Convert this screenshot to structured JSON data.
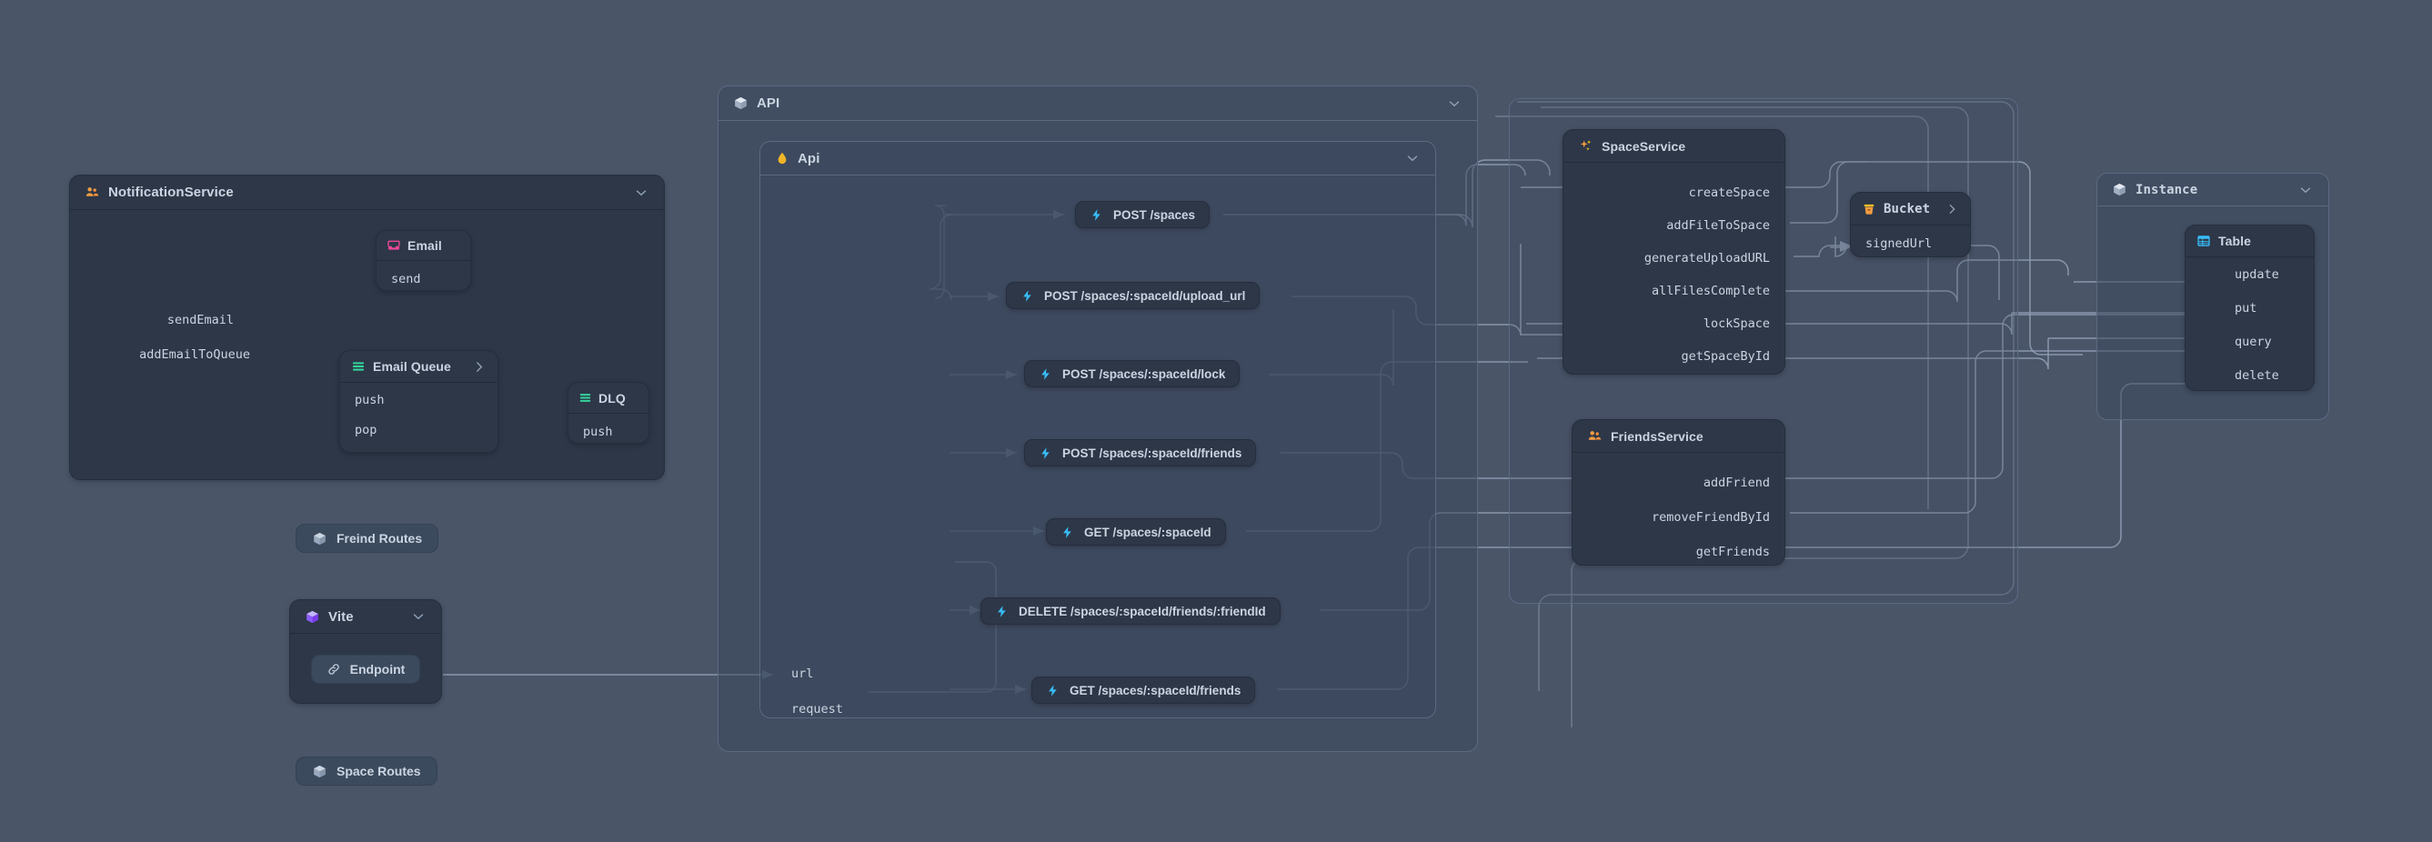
{
  "canvas": {
    "background": "#4a5568",
    "node_bg": "#2d3748",
    "group_bg": "rgba(57,70,92,.52)",
    "edge_color": "#94a3b8",
    "text_color": "#cbd5e1"
  },
  "nodes": {
    "notification_service": {
      "title": "NotificationService",
      "icon": "people-icon",
      "icon_color": "#f59e42",
      "collapse_icon": "chevron-down-icon",
      "members": [
        {
          "label": "sendEmail"
        },
        {
          "label": "addEmailToQueue"
        }
      ],
      "children": {
        "email": {
          "title": "Email",
          "icon": "inbox-icon",
          "icon_color": "#ec4899",
          "members": [
            {
              "label": "send"
            }
          ]
        },
        "email_queue": {
          "title": "Email Queue",
          "icon": "queue-icon",
          "icon_color": "#34d399",
          "expand_icon": "chevron-right-icon",
          "members": [
            {
              "label": "push"
            },
            {
              "label": "pop"
            }
          ]
        },
        "dlq": {
          "title": "DLQ",
          "icon": "queue-icon",
          "icon_color": "#34d399",
          "members": [
            {
              "label": "push"
            }
          ]
        }
      }
    },
    "freind_routes": {
      "title": "Freind Routes",
      "icon": "cube-icon",
      "icon_color": "#94a3b8"
    },
    "space_routes": {
      "title": "Space Routes",
      "icon": "cube-icon",
      "icon_color": "#94a3b8"
    },
    "vite": {
      "title": "Vite",
      "icon": "cube-icon",
      "icon_color": "#a78bfa",
      "collapse_icon": "chevron-down-icon",
      "endpoint": {
        "label": "Endpoint",
        "icon": "link-icon"
      }
    },
    "api_outer": {
      "title": "API",
      "icon": "cube-icon",
      "icon_color": "#cbd5e1",
      "collapse_icon": "chevron-down-icon"
    },
    "api_inner": {
      "title": "Api",
      "icon": "droplet-icon",
      "icon_color": "#f0b429",
      "collapse_icon": "chevron-down-icon",
      "members": [
        {
          "label": "url"
        },
        {
          "label": "request"
        }
      ]
    },
    "space_service": {
      "title": "SpaceService",
      "icon": "sparkles-icon",
      "icon_color": "#f59e42",
      "members": [
        {
          "label": "createSpace"
        },
        {
          "label": "addFileToSpace"
        },
        {
          "label": "generateUploadURL"
        },
        {
          "label": "allFilesComplete"
        },
        {
          "label": "lockSpace"
        },
        {
          "label": "getSpaceById"
        }
      ]
    },
    "friends_service": {
      "title": "FriendsService",
      "icon": "people-icon",
      "icon_color": "#f59e42",
      "members": [
        {
          "label": "addFriend"
        },
        {
          "label": "removeFriendById"
        },
        {
          "label": "getFriends"
        }
      ]
    },
    "bucket": {
      "title": "Bucket",
      "icon": "bucket-icon",
      "icon_color": "#f59e42",
      "expand_icon": "chevron-right-icon",
      "members": [
        {
          "label": "signedUrl"
        }
      ]
    },
    "instance": {
      "title": "Instance",
      "icon": "cube-icon",
      "icon_color": "#cbd5e1",
      "collapse_icon": "chevron-down-icon"
    },
    "table": {
      "title": "Table",
      "icon": "table-icon",
      "icon_color": "#38bdf8",
      "members": [
        {
          "label": "update"
        },
        {
          "label": "put"
        },
        {
          "label": "query"
        },
        {
          "label": "delete"
        }
      ]
    }
  },
  "routes": [
    {
      "id": "post-spaces",
      "icon": "lightning-icon",
      "label": "POST /spaces"
    },
    {
      "id": "post-upload-url",
      "icon": "lightning-icon",
      "label": "POST /spaces/:spaceId/upload_url"
    },
    {
      "id": "post-lock",
      "icon": "lightning-icon",
      "label": "POST /spaces/:spaceId/lock"
    },
    {
      "id": "post-friends",
      "icon": "lightning-icon",
      "label": "POST /spaces/:spaceId/friends"
    },
    {
      "id": "get-space",
      "icon": "lightning-icon",
      "label": "GET /spaces/:spaceId"
    },
    {
      "id": "delete-friend",
      "icon": "lightning-icon",
      "label": "DELETE /spaces/:spaceId/friends/:friendId"
    },
    {
      "id": "get-friends",
      "icon": "lightning-icon",
      "label": "GET /spaces/:spaceId/friends"
    }
  ]
}
